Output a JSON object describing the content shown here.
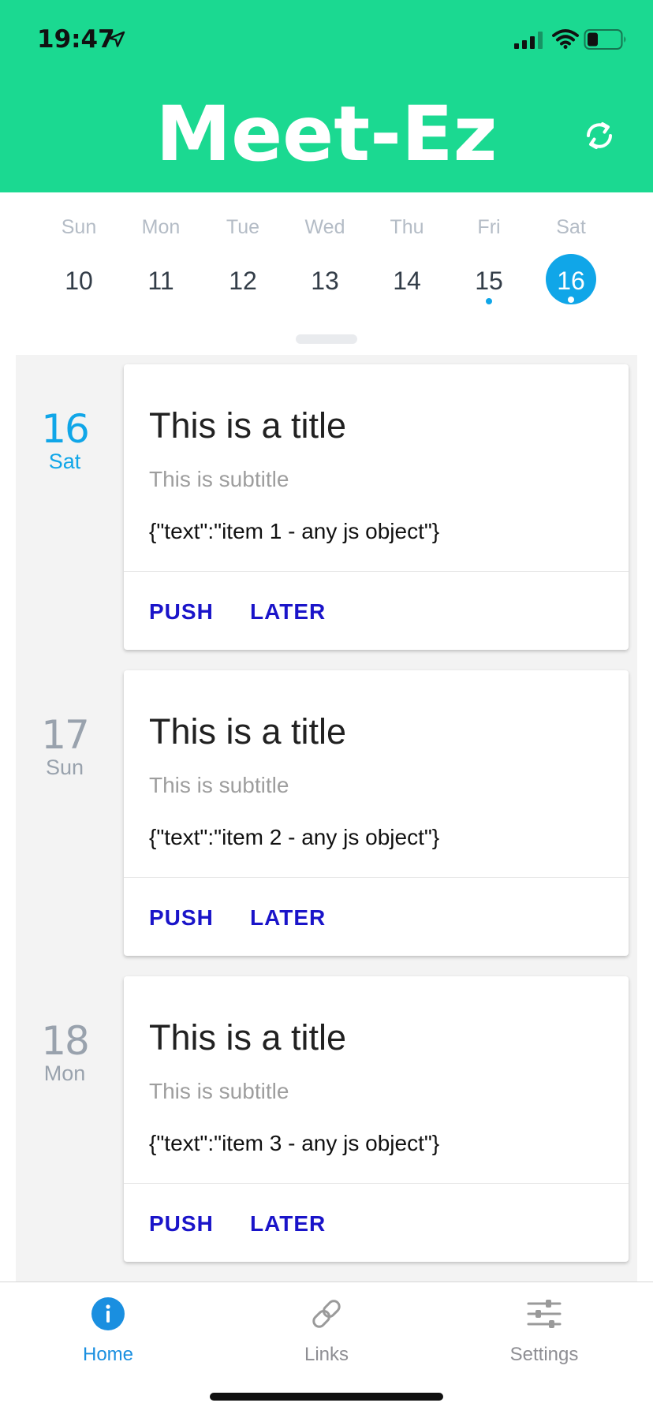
{
  "status_bar": {
    "time": "19:47"
  },
  "header": {
    "title": "Meet-Ez",
    "refresh_icon": "refresh-icon"
  },
  "week": {
    "days": [
      {
        "dow": "Sun",
        "num": "10"
      },
      {
        "dow": "Mon",
        "num": "11"
      },
      {
        "dow": "Tue",
        "num": "12"
      },
      {
        "dow": "Wed",
        "num": "13"
      },
      {
        "dow": "Thu",
        "num": "14"
      },
      {
        "dow": "Fri",
        "num": "15",
        "marked": true
      },
      {
        "dow": "Sat",
        "num": "16",
        "selected": true,
        "marked": true
      }
    ]
  },
  "agenda": {
    "items": [
      {
        "day_num": "16",
        "day_dow": "Sat",
        "title": "This is a title",
        "subtitle": "This is subtitle",
        "body": "{\"text\":\"item 1 - any js object\"}",
        "push": "PUSH",
        "later": "LATER"
      },
      {
        "day_num": "17",
        "day_dow": "Sun",
        "title": "This is a title",
        "subtitle": "This is subtitle",
        "body": "{\"text\":\"item 2 - any js object\"}",
        "push": "PUSH",
        "later": "LATER"
      },
      {
        "day_num": "18",
        "day_dow": "Mon",
        "title": "This is a title",
        "subtitle": "This is subtitle",
        "body": "{\"text\":\"item 3 - any js object\"}",
        "push": "PUSH",
        "later": "LATER"
      }
    ]
  },
  "tabs": [
    {
      "label": "Home",
      "icon": "info-icon",
      "active": true
    },
    {
      "label": "Links",
      "icon": "link-icon"
    },
    {
      "label": "Settings",
      "icon": "sliders-icon"
    }
  ],
  "colors": {
    "header_bg": "#1bd991",
    "accent_blue": "#10a6e8",
    "button_text": "#1a14c9",
    "tab_active": "#1a8fe0"
  }
}
